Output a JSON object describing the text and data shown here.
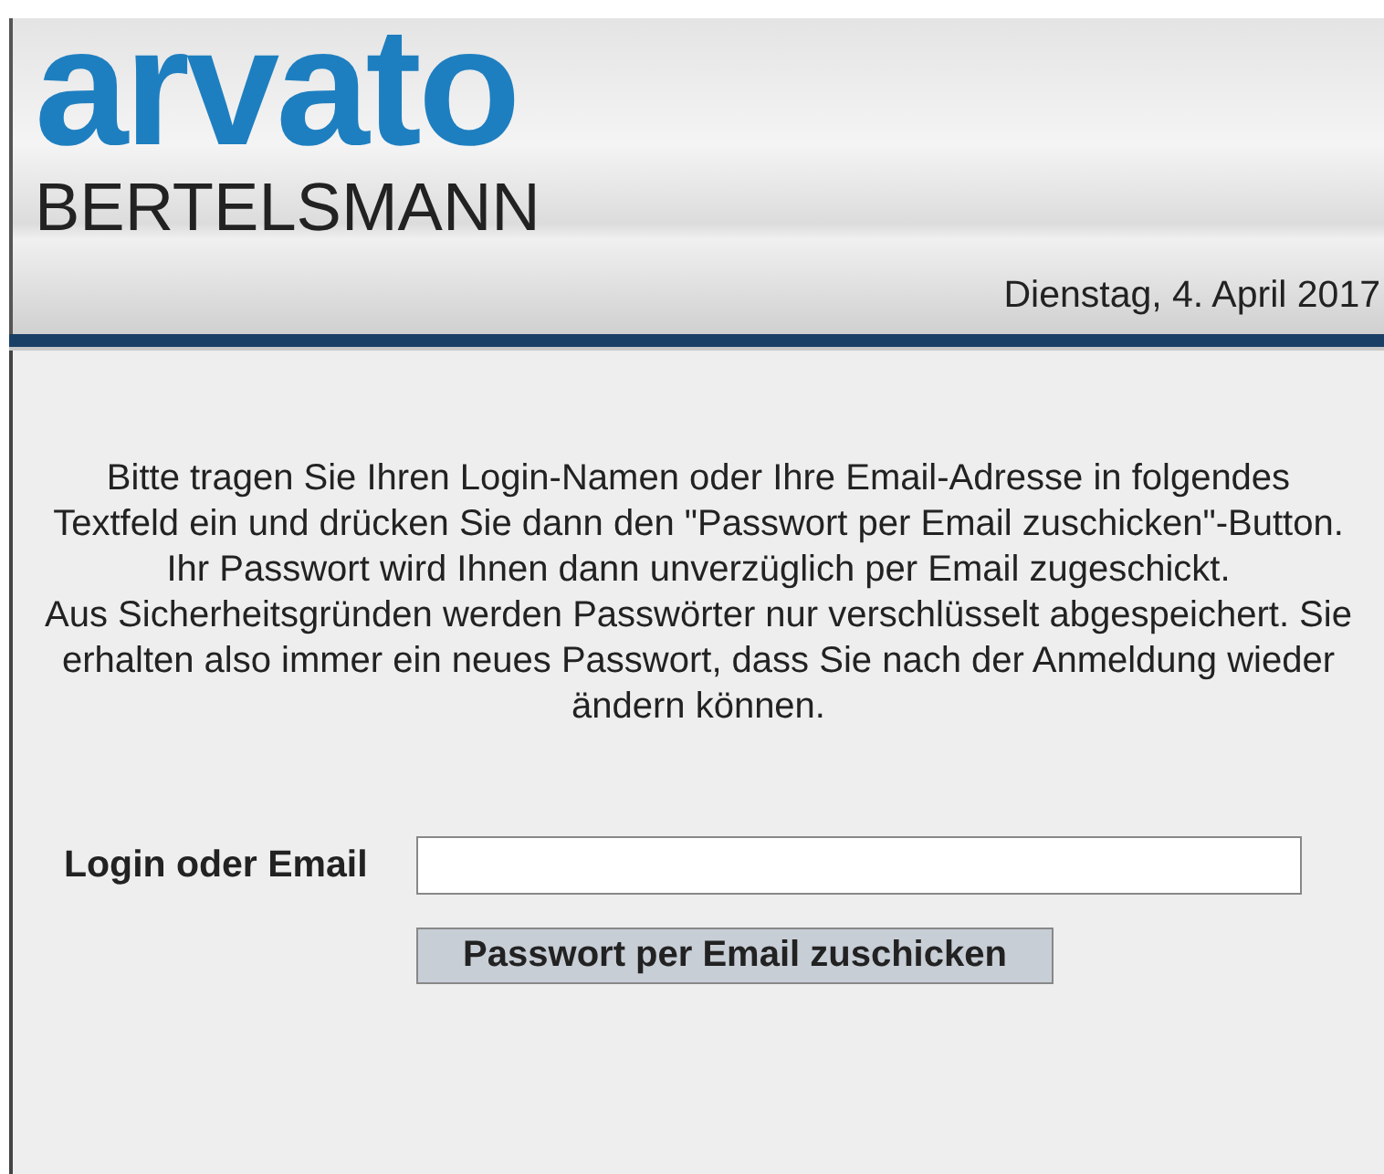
{
  "header": {
    "logo": {
      "name": "arvato",
      "company": "BERTELSMANN"
    },
    "date": "Dienstag, 4. April 2017"
  },
  "instructions": "Bitte tragen Sie Ihren Login-Namen oder Ihre Email-Adresse in folgendes\nTextfeld ein und drücken Sie dann den \"Passwort per Email zuschicken\"-Button.\nIhr Passwort wird Ihnen dann unverzüglich per Email zugeschickt.\nAus Sicherheitsgründen werden Passwörter nur verschlüsselt abgespeichert. Sie\nerhalten also immer ein neues Passwort, dass Sie nach der Anmeldung wieder\nändern können.",
  "form": {
    "label": "Login oder Email",
    "button": "Passwort per Email zuschicken"
  }
}
